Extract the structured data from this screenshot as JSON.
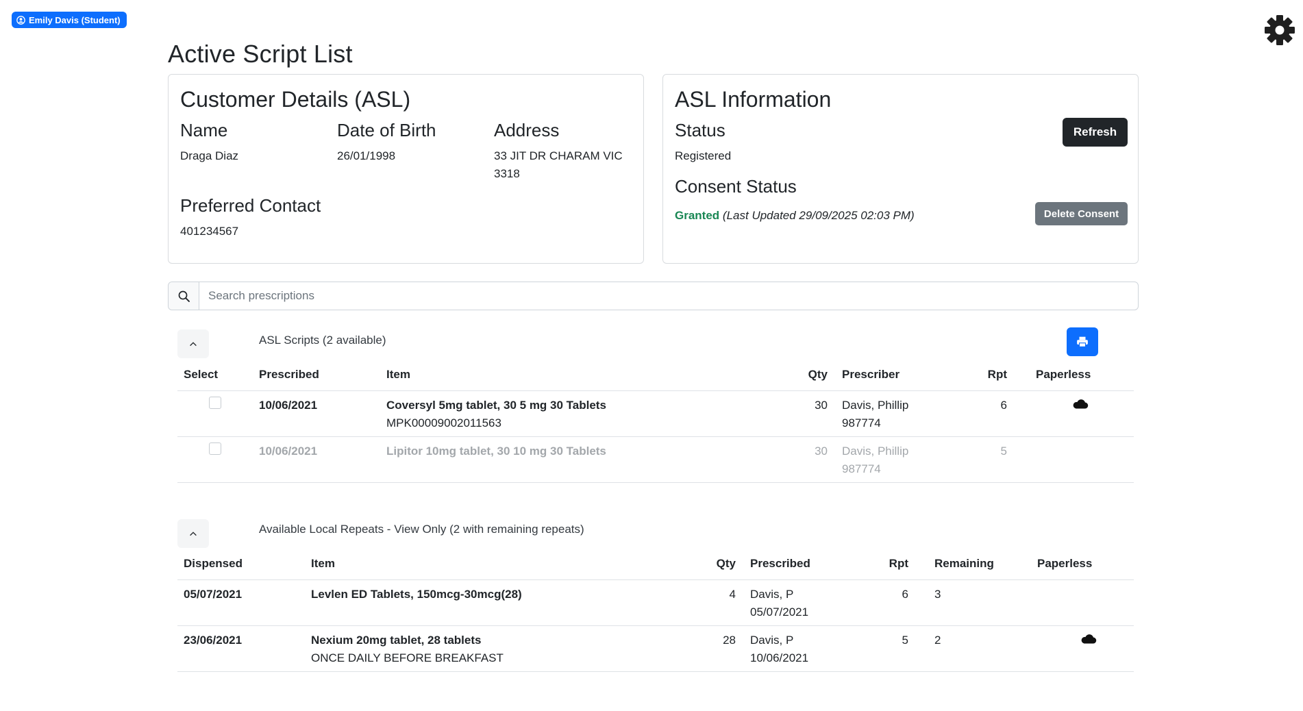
{
  "user": {
    "badge": "Emily Davis (Student)"
  },
  "page": {
    "title": "Active Script List"
  },
  "customer": {
    "title": "Customer Details (ASL)",
    "name_label": "Name",
    "name": "Draga Diaz",
    "dob_label": "Date of Birth",
    "dob": "26/01/1998",
    "address_label": "Address",
    "address": "33 JIT DR CHARAM VIC 3318",
    "contact_label": "Preferred Contact",
    "contact": "401234567"
  },
  "asl": {
    "title": "ASL Information",
    "status_label": "Status",
    "status": "Registered",
    "refresh_label": "Refresh",
    "consent_label": "Consent Status",
    "consent_value": "Granted",
    "consent_updated": "(Last Updated 29/09/2025 02:03 PM)",
    "delete_label": "Delete Consent"
  },
  "search": {
    "placeholder": "Search prescriptions"
  },
  "asl_scripts": {
    "title": "ASL Scripts (2 available)",
    "headers": {
      "select": "Select",
      "prescribed": "Prescribed",
      "item": "Item",
      "qty": "Qty",
      "prescriber": "Prescriber",
      "rpt": "Rpt",
      "paperless": "Paperless"
    },
    "rows": [
      {
        "prescribed": "10/06/2021",
        "item": "Coversyl 5mg tablet, 30 5 mg 30 Tablets",
        "item_sub": "MPK00009002011563",
        "qty": "30",
        "prescriber": "Davis, Phillip",
        "prescriber_id": "987774",
        "rpt": "6",
        "paperless": true,
        "disabled": false
      },
      {
        "prescribed": "10/06/2021",
        "item": "Lipitor 10mg tablet, 30 10 mg 30 Tablets",
        "item_sub": "",
        "qty": "30",
        "prescriber": "Davis, Phillip",
        "prescriber_id": "987774",
        "rpt": "5",
        "paperless": false,
        "disabled": true
      }
    ]
  },
  "local_repeats": {
    "title": "Available Local Repeats - View Only (2 with remaining repeats)",
    "headers": {
      "dispensed": "Dispensed",
      "item": "Item",
      "qty": "Qty",
      "prescribed": "Prescribed",
      "rpt": "Rpt",
      "remaining": "Remaining",
      "paperless": "Paperless"
    },
    "rows": [
      {
        "dispensed": "05/07/2021",
        "item": "Levlen ED Tablets, 150mcg-30mcg(28)",
        "item_sub": "",
        "qty": "4",
        "prescriber": "Davis, P",
        "prescribed_date": "05/07/2021",
        "rpt": "6",
        "remaining": "3",
        "paperless": false
      },
      {
        "dispensed": "23/06/2021",
        "item": "Nexium 20mg tablet, 28 tablets",
        "item_sub": "ONCE DAILY BEFORE BREAKFAST",
        "qty": "28",
        "prescriber": "Davis, P",
        "prescribed_date": "10/06/2021",
        "rpt": "5",
        "remaining": "2",
        "paperless": true
      }
    ]
  },
  "icons": {
    "user": "user-circle-icon",
    "settings": "gear-icon",
    "search": "search-icon",
    "collapse": "chevron-up-icon",
    "print": "printer-icon",
    "paperless": "cloud-icon"
  },
  "colors": {
    "primary": "#0d6efd",
    "dark": "#212529",
    "secondary": "#6c757d",
    "success": "#198754"
  }
}
